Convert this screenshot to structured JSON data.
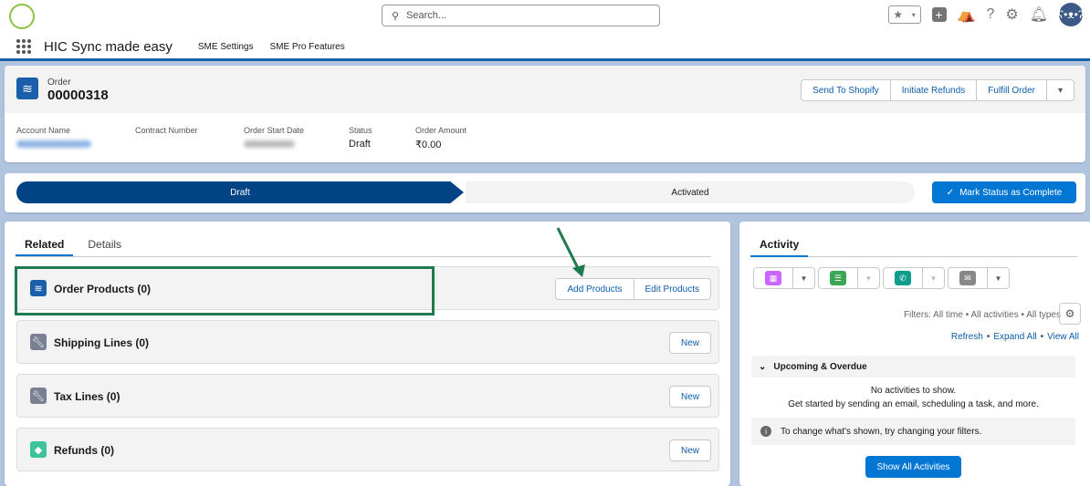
{
  "header": {
    "search_placeholder": "Search...",
    "app_name": "HIC Sync made easy",
    "nav": [
      "SME Settings",
      "SME Pro Features"
    ],
    "avatar_icon": "bear-avatar"
  },
  "record": {
    "object": "Order",
    "number": "00000318",
    "actions": [
      "Send To Shopify",
      "Initiate Refunds",
      "Fulfill Order"
    ],
    "fields": [
      {
        "label": "Account Name",
        "value": ""
      },
      {
        "label": "Contract Number",
        "value": ""
      },
      {
        "label": "Order Start Date",
        "value": ""
      },
      {
        "label": "Status",
        "value": "Draft"
      },
      {
        "label": "Order Amount",
        "value": "₹0.00"
      }
    ]
  },
  "path": {
    "stages": [
      "Draft",
      "Activated"
    ],
    "current": "Draft",
    "mark_label": "Mark Status as Complete"
  },
  "related": {
    "tabs": [
      "Related",
      "Details"
    ],
    "lists": [
      {
        "title": "Order Products (0)",
        "buttons": [
          "Add Products",
          "Edit Products"
        ],
        "color": "#1b5faa"
      },
      {
        "title": "Shipping Lines (0)",
        "buttons": [
          "New"
        ],
        "color": "#7a7f94"
      },
      {
        "title": "Tax Lines (0)",
        "buttons": [
          "New"
        ],
        "color": "#7a7f94"
      },
      {
        "title": "Refunds (0)",
        "buttons": [
          "New"
        ],
        "color": "#3ec29a"
      }
    ]
  },
  "activity": {
    "tab": "Activity",
    "filters": "Filters: All time • All activities • All types",
    "links": [
      "Refresh",
      "Expand All",
      "View All"
    ],
    "section": "Upcoming & Overdue",
    "empty1": "No activities to show.",
    "empty2": "Get started by sending an email, scheduling a task, and more.",
    "info": "To change what's shown, try changing your filters.",
    "show_all": "Show All Activities"
  }
}
